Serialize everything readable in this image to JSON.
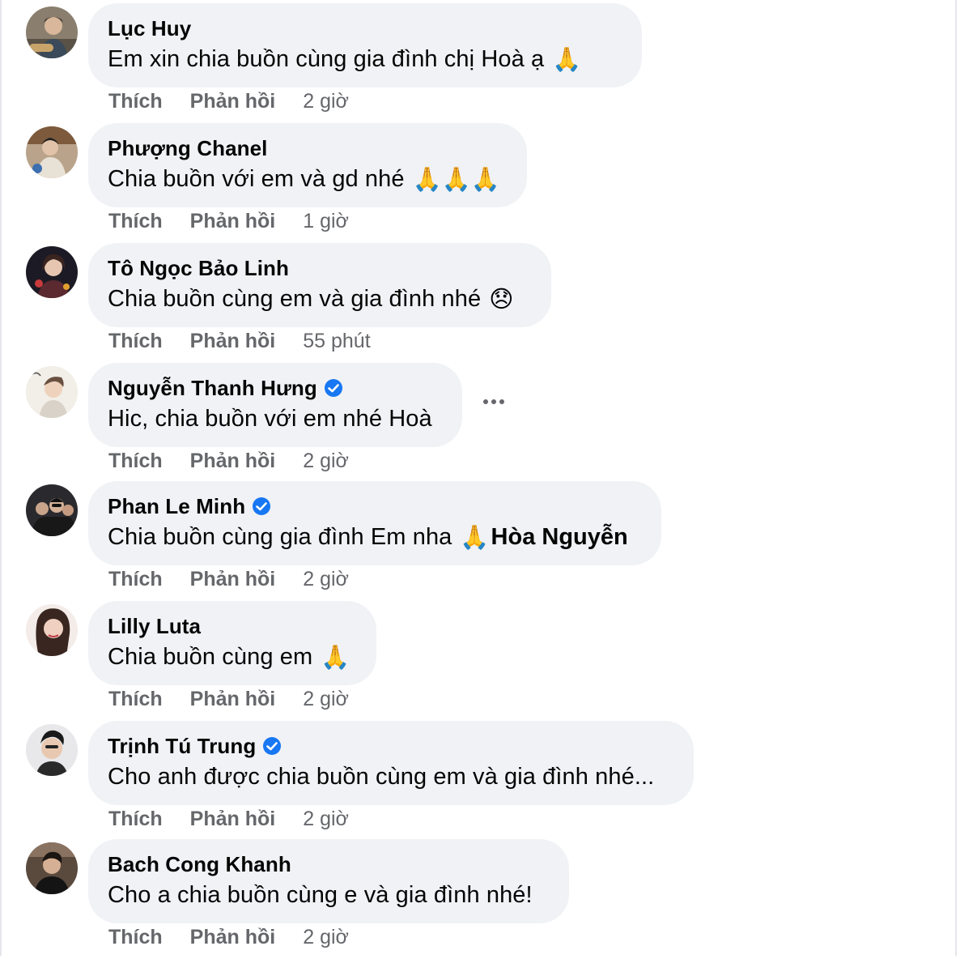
{
  "labels": {
    "like": "Thích",
    "reply": "Phản hồi"
  },
  "colors": {
    "bubble": "#f0f2f5",
    "meta": "#65676b",
    "verified": "#1877f2"
  },
  "comments": [
    {
      "name": "Lục Huy",
      "text": "Em xin chia buồn cùng gia đình chị Hoà ạ",
      "emoji": "🙏",
      "mention": "",
      "time": "2 giờ",
      "verified": false
    },
    {
      "name": "Phượng Chanel",
      "text": "Chia buồn với em và gd nhé",
      "emoji": "🙏🙏🙏",
      "mention": "",
      "time": "1 giờ",
      "verified": false
    },
    {
      "name": "Tô Ngọc Bảo Linh",
      "text": "Chia buồn cùng em và gia đình nhé",
      "emoji": "😞",
      "mention": "",
      "time": "55 phút",
      "verified": false
    },
    {
      "name": "Nguyễn Thanh Hưng",
      "text": "Hic, chia buồn với em nhé Hoà",
      "emoji": "",
      "mention": "",
      "time": "2 giờ",
      "verified": true
    },
    {
      "name": "Phan Le Minh",
      "text": "Chia buồn cùng gia đình Em nha",
      "emoji": "🙏",
      "mention": "Hòa Nguyễn",
      "time": "2 giờ",
      "verified": true
    },
    {
      "name": "Lilly Luta",
      "text": "Chia buồn cùng em",
      "emoji": "🙏",
      "mention": "",
      "time": "2 giờ",
      "verified": false
    },
    {
      "name": "Trịnh Tú Trung",
      "text": "Cho anh được chia buồn cùng em và gia đình nhé...",
      "emoji": "",
      "mention": "",
      "time": "2 giờ",
      "verified": true
    },
    {
      "name": "Bach Cong Khanh",
      "text": "Cho a chia buồn cùng e và gia đình nhé!",
      "emoji": "",
      "mention": "",
      "time": "2 giờ",
      "verified": false
    }
  ]
}
